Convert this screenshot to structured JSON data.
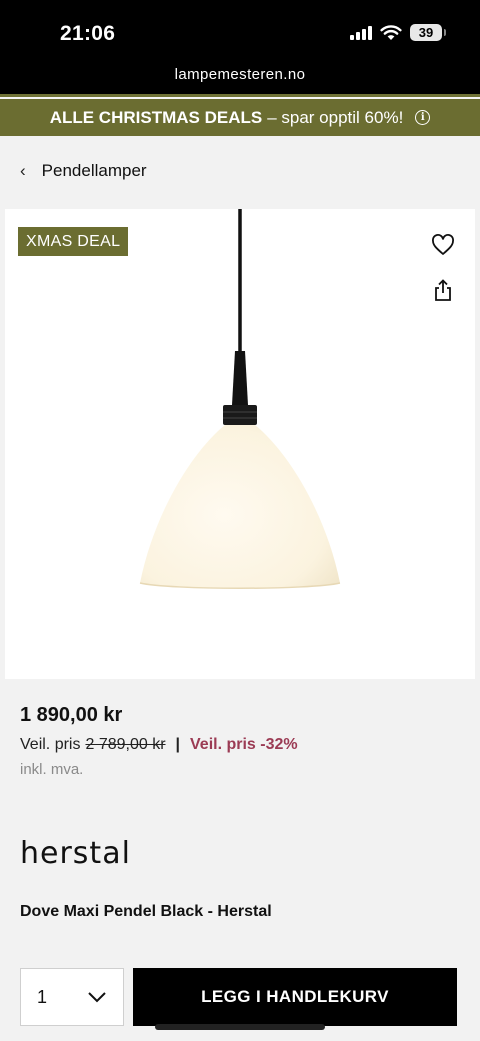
{
  "status_bar": {
    "time": "21:06",
    "battery": "39"
  },
  "browser": {
    "url": "lampemesteren.no"
  },
  "promo": {
    "strong": "ALLE CHRISTMAS DEALS",
    "rest": "– spar opptil 60%!",
    "info": "i"
  },
  "breadcrumb": {
    "chevron": "‹",
    "label": "Pendellamper"
  },
  "product": {
    "badge": "XMAS DEAL",
    "price": "1 890,00 kr",
    "veil_label": "Veil. pris",
    "veil_price": "2 789,00 kr",
    "separator": "|",
    "discount": "Veil. pris -32%",
    "vat": "inkl. mva.",
    "brand": "herstal",
    "name": "Dove Maxi Pendel Black - Herstal"
  },
  "cart": {
    "quantity": "1",
    "add_label": "LEGG I HANDLEKURV"
  },
  "colors": {
    "accent_olive": "#6b6d31",
    "discount_red": "#9b3b54"
  }
}
